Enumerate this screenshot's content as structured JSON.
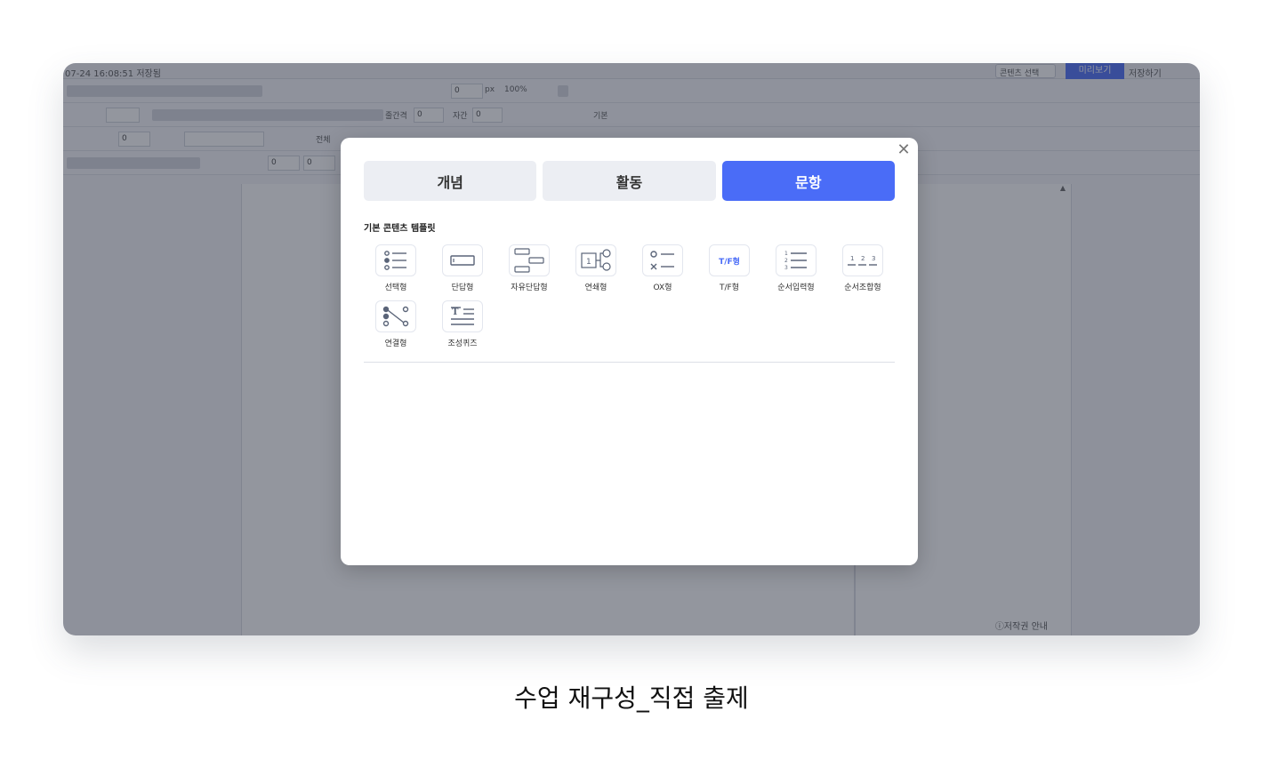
{
  "editor": {
    "saved_status": "07-24 16:08:51 저장됨",
    "content_select": "콘텐츠 선택",
    "preview_label": "미리보기",
    "save_label": "저장하기",
    "toolbar": {
      "px_value": "0",
      "px_unit": "px",
      "zoom": "100%",
      "line_spacing_label": "줄간격",
      "line_spacing_value": "0",
      "letter_spacing_label": "자간",
      "letter_spacing_value": "0",
      "default_label": "기본",
      "all_label": "전체",
      "size_value": "0",
      "width_value": "0",
      "height_value": "0"
    },
    "copyright_link": "ⓘ저작권 안내"
  },
  "modal": {
    "tabs": [
      {
        "label": "개념",
        "active": false
      },
      {
        "label": "활동",
        "active": false
      },
      {
        "label": "문항",
        "active": true
      }
    ],
    "section_title": "기본 콘텐츠 템플릿",
    "templates": [
      {
        "label": "선택형",
        "icon": "multiple-choice-icon"
      },
      {
        "label": "단답형",
        "icon": "short-answer-icon"
      },
      {
        "label": "자유단답형",
        "icon": "free-short-answer-icon"
      },
      {
        "label": "연쇄형",
        "icon": "chain-icon"
      },
      {
        "label": "OX형",
        "icon": "ox-icon"
      },
      {
        "label": "T/F형",
        "icon": "true-false-icon",
        "icon_text": "T/F형"
      },
      {
        "label": "순서입력형",
        "icon": "order-input-icon"
      },
      {
        "label": "순서조합형",
        "icon": "order-combine-icon"
      },
      {
        "label": "연결형",
        "icon": "connect-icon"
      },
      {
        "label": "조성퀴즈",
        "icon": "compose-quiz-icon"
      }
    ],
    "accent_color": "#4a6cf7"
  },
  "caption": "수업 재구성_직접 출제"
}
